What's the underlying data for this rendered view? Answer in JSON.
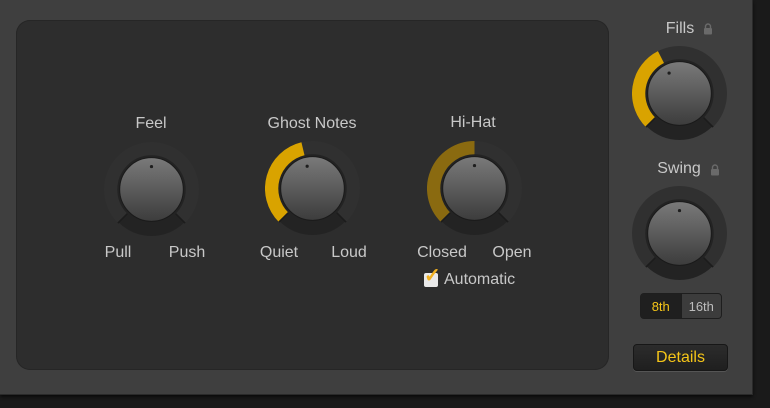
{
  "colors": {
    "accent": "#d9a300",
    "accent_dim": "#8a6a10",
    "text": "#c8c8c8"
  },
  "knobs": {
    "feel": {
      "title": "Feel",
      "left_label": "Pull",
      "right_label": "Push",
      "fill": 0.5,
      "active": false
    },
    "ghost_notes": {
      "title": "Ghost Notes",
      "left_label": "Quiet",
      "right_label": "Loud",
      "fill": 0.45,
      "active": true
    },
    "hihat": {
      "title": "Hi-Hat",
      "left_label": "Closed",
      "right_label": "Open",
      "fill": 0.5,
      "active": false,
      "dim": true
    }
  },
  "automatic": {
    "label": "Automatic",
    "checked": true
  },
  "sidebar": {
    "fills": {
      "title": "Fills",
      "locked": true,
      "fill": 0.4,
      "active": true
    },
    "swing": {
      "title": "Swing",
      "locked": true,
      "fill": 0.5,
      "active": false
    },
    "resolution": {
      "options": [
        "8th",
        "16th"
      ],
      "selected": "8th"
    },
    "details_label": "Details"
  },
  "icons": {
    "lock": "lock-icon",
    "check": "checkmark-icon"
  }
}
